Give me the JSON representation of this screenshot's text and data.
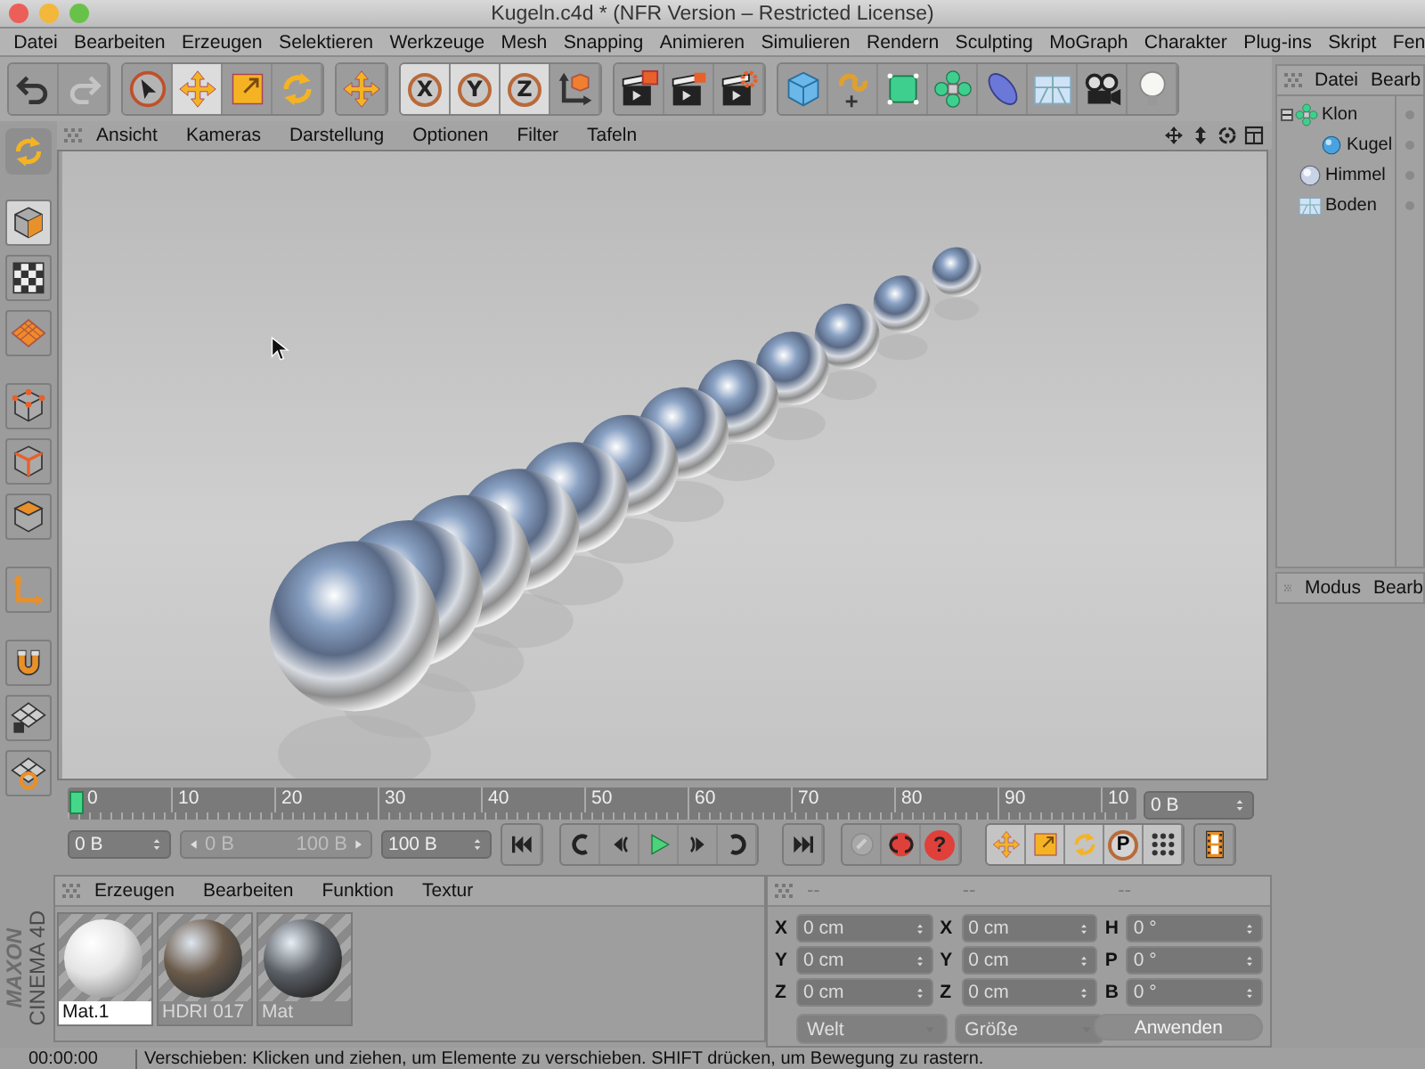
{
  "window": {
    "title": "Kugeln.c4d * (NFR Version – Restricted License)"
  },
  "menu": [
    "Datei",
    "Bearbeiten",
    "Erzeugen",
    "Selektieren",
    "Werkzeuge",
    "Mesh",
    "Snapping",
    "Animieren",
    "Simulieren",
    "Rendern",
    "Sculpting",
    "MoGraph",
    "Charakter",
    "Plug-ins",
    "Skript",
    "Fen"
  ],
  "toolbar_groups": [
    {
      "items": [
        {
          "kind": "undo",
          "selected": false
        },
        {
          "kind": "redo",
          "selected": false
        }
      ]
    },
    {
      "items": [
        {
          "kind": "select",
          "selected": false
        },
        {
          "kind": "move",
          "selected": true
        },
        {
          "kind": "scale",
          "selected": false
        },
        {
          "kind": "rotate",
          "selected": false
        }
      ]
    },
    {
      "items": [
        {
          "kind": "move-add",
          "selected": false
        }
      ]
    },
    {
      "items": [
        {
          "kind": "axis",
          "label": "X",
          "selected": true
        },
        {
          "kind": "axis",
          "label": "Y",
          "selected": true
        },
        {
          "kind": "axis",
          "label": "Z",
          "selected": true
        },
        {
          "kind": "coords",
          "selected": false
        }
      ]
    },
    {
      "items": [
        {
          "kind": "render-view",
          "selected": false
        },
        {
          "kind": "render",
          "selected": false
        },
        {
          "kind": "render-settings",
          "selected": false
        }
      ]
    },
    {
      "items": [
        {
          "kind": "cube",
          "selected": false
        },
        {
          "kind": "spline",
          "selected": false
        },
        {
          "kind": "subdivide",
          "selected": false
        },
        {
          "kind": "cloner",
          "selected": false
        },
        {
          "kind": "deformer",
          "selected": false
        },
        {
          "kind": "floor",
          "selected": false
        },
        {
          "kind": "camera",
          "selected": false
        },
        {
          "kind": "light",
          "selected": false
        }
      ]
    }
  ],
  "left_tools": [
    {
      "kind": "model",
      "selected": true
    },
    {
      "kind": "texture",
      "selected": false
    },
    {
      "kind": "workplane",
      "selected": false
    },
    {
      "kind": "points",
      "selected": false
    },
    {
      "kind": "edges",
      "selected": false
    },
    {
      "kind": "polygons",
      "selected": false
    },
    {
      "kind": "axis-mode",
      "selected": false
    },
    {
      "kind": "magnet",
      "selected": false
    },
    {
      "kind": "grid-lock",
      "selected": false
    },
    {
      "kind": "grid-snap",
      "selected": false
    }
  ],
  "viewport": {
    "menu": [
      "Ansicht",
      "Kameras",
      "Darstellung",
      "Optionen",
      "Filter",
      "Tafeln"
    ]
  },
  "timeline": {
    "ticks": [
      "0",
      "10",
      "20",
      "30",
      "40",
      "50",
      "60",
      "70",
      "80",
      "90",
      "10"
    ],
    "level": 0,
    "frame": "0 B"
  },
  "transport": {
    "start": "0 B",
    "range_start": "0 B",
    "range_end": "100 B",
    "end": "100 B",
    "groups": [
      {
        "items": [
          {
            "kind": "go-start"
          }
        ]
      },
      {
        "items": [
          {
            "kind": "prev-key"
          },
          {
            "kind": "prev-frame"
          },
          {
            "kind": "play"
          },
          {
            "kind": "next-frame"
          },
          {
            "kind": "next-key"
          }
        ]
      },
      {
        "items": [
          {
            "kind": "go-end"
          }
        ]
      },
      {
        "items": [
          {
            "kind": "record"
          },
          {
            "kind": "autokey"
          },
          {
            "kind": "keyframe-help",
            "label": "?"
          }
        ]
      },
      {
        "items": [
          {
            "kind": "move"
          },
          {
            "kind": "scale"
          },
          {
            "kind": "rotate"
          },
          {
            "kind": "param",
            "label": "P"
          },
          {
            "kind": "points-grid"
          }
        ]
      },
      {
        "items": [
          {
            "kind": "film"
          }
        ]
      }
    ]
  },
  "object_manager": {
    "menu": [
      "Datei",
      "Bearb"
    ],
    "objects": [
      {
        "name": "Klon",
        "kind": "cloner",
        "expanded": true,
        "children": [
          {
            "name": "Kugel",
            "kind": "sphere"
          }
        ]
      },
      {
        "name": "Himmel",
        "kind": "sky"
      },
      {
        "name": "Boden",
        "kind": "floor"
      }
    ]
  },
  "attribute_manager": {
    "menu": [
      "Modus",
      "Bearb"
    ]
  },
  "material_manager": {
    "menu": [
      "Erzeugen",
      "Bearbeiten",
      "Funktion",
      "Textur"
    ],
    "materials": [
      {
        "name": "Mat.1",
        "kind": "matte",
        "selected": true
      },
      {
        "name": "HDRI 017",
        "kind": "hdri",
        "selected": false
      },
      {
        "name": "Mat",
        "kind": "chrome",
        "selected": false
      }
    ]
  },
  "logo": {
    "brand": "MAXON",
    "product": "CINEMA 4D"
  },
  "coordinates": {
    "headers": [
      "--",
      "--",
      "--"
    ],
    "disabled": true,
    "columns": [
      {
        "rows": [
          {
            "label": "X",
            "value": "0 cm"
          },
          {
            "label": "Y",
            "value": "0 cm"
          },
          {
            "label": "Z",
            "value": "0 cm"
          }
        ]
      },
      {
        "rows": [
          {
            "label": "X",
            "value": "0 cm"
          },
          {
            "label": "Y",
            "value": "0 cm"
          },
          {
            "label": "Z",
            "value": "0 cm"
          }
        ]
      },
      {
        "rows": [
          {
            "label": "H",
            "value": "0 °"
          },
          {
            "label": "P",
            "value": "0 °"
          },
          {
            "label": "B",
            "value": "0 °"
          }
        ]
      }
    ],
    "dropdowns": [
      "Welt",
      "Größe"
    ],
    "apply": "Anwenden"
  },
  "status_bar": {
    "time": "00:00:00",
    "message": "Verschieben: Klicken und ziehen, um Elemente zu verschieben. SHIFT drücken, um Bewegung zu rastern."
  }
}
